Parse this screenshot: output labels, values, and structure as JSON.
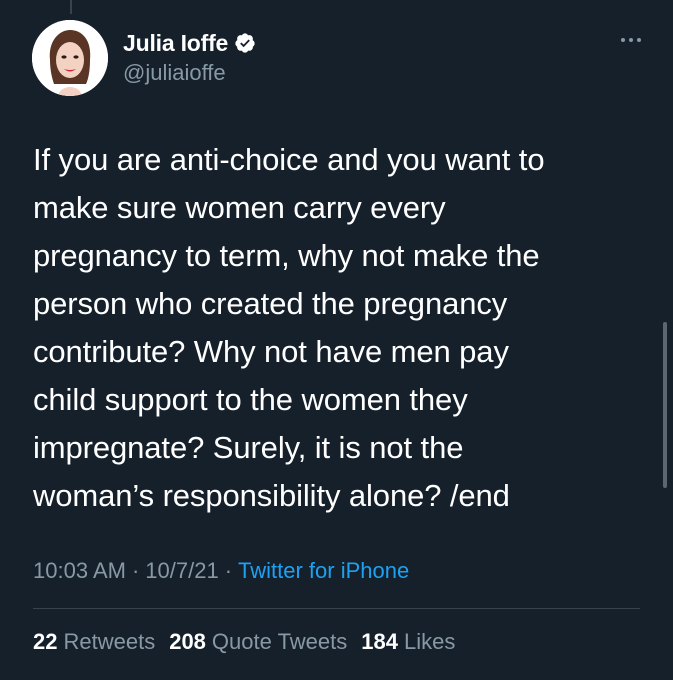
{
  "author": {
    "display_name": "Julia Ioffe",
    "handle": "@juliaioffe",
    "verified": true,
    "avatar_icon": "avatar-portrait-illustration",
    "verified_icon": "verified-badge-icon"
  },
  "tweet": {
    "text": "If you are anti-choice and you want to\nmake sure women carry every\npregnancy to term, why not make the\nperson who created the pregnancy\ncontribute? Why not have men pay\nchild support to the women they\nimpregnate? Surely, it is not the\nwoman’s responsibility alone? /end"
  },
  "meta": {
    "time": "10:03 AM",
    "separator": "·",
    "date": "10/7/21",
    "source": "Twitter for iPhone"
  },
  "stats": {
    "retweets_count": "22",
    "retweets_label": "Retweets",
    "quotes_count": "208",
    "quotes_label": "Quote Tweets",
    "likes_count": "184",
    "likes_label": "Likes"
  },
  "colors": {
    "background": "#15202b",
    "text": "#ffffff",
    "secondary_text": "#8899a6",
    "link": "#1da1f2",
    "divider": "#38444d"
  }
}
